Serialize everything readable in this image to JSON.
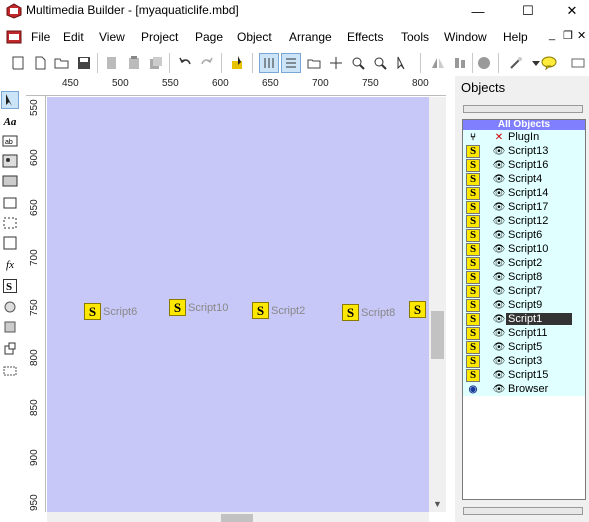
{
  "window": {
    "title": "Multimedia Builder - [myaquaticlife.mbd]"
  },
  "menu": {
    "items": [
      "File",
      "Edit",
      "View",
      "Project",
      "Page",
      "Object",
      "Arrange",
      "Effects",
      "Tools",
      "Window",
      "Help"
    ]
  },
  "ruler": {
    "horizontal": [
      "450",
      "500",
      "550",
      "600",
      "650",
      "700",
      "750",
      "800"
    ],
    "vertical": [
      "550",
      "600",
      "650",
      "700",
      "750",
      "800",
      "850",
      "900",
      "950"
    ]
  },
  "canvas": {
    "background": "#c8c8f8",
    "objects": [
      {
        "label": "Script6"
      },
      {
        "label": "Script10"
      },
      {
        "label": "Script2"
      },
      {
        "label": "Script8"
      },
      {
        "label": ""
      }
    ]
  },
  "objects_panel": {
    "title": "Objects",
    "header": "All Objects",
    "items": [
      {
        "type": "plugin",
        "name": "PlugIn"
      },
      {
        "type": "script",
        "name": "Script13"
      },
      {
        "type": "script",
        "name": "Script16"
      },
      {
        "type": "script",
        "name": "Script4"
      },
      {
        "type": "script",
        "name": "Script14"
      },
      {
        "type": "script",
        "name": "Script17"
      },
      {
        "type": "script",
        "name": "Script12"
      },
      {
        "type": "script",
        "name": "Script6"
      },
      {
        "type": "script",
        "name": "Script10"
      },
      {
        "type": "script",
        "name": "Script2"
      },
      {
        "type": "script",
        "name": "Script8"
      },
      {
        "type": "script",
        "name": "Script7"
      },
      {
        "type": "script",
        "name": "Script9"
      },
      {
        "type": "script",
        "name": "Script1",
        "selected": true
      },
      {
        "type": "script",
        "name": "Script11"
      },
      {
        "type": "script",
        "name": "Script5"
      },
      {
        "type": "script",
        "name": "Script3"
      },
      {
        "type": "script",
        "name": "Script15"
      },
      {
        "type": "browser",
        "name": "Browser"
      }
    ]
  },
  "glyphs": {
    "minimize": "—",
    "maximize": "☐",
    "close": "✕",
    "mdi_min": "_",
    "mdi_restore": "❐",
    "mdi_close": "✕",
    "script_letter": "S",
    "eye": "👁",
    "plugin_type": "⑂",
    "plugin_eye": "✕",
    "browser_type": "◉"
  }
}
